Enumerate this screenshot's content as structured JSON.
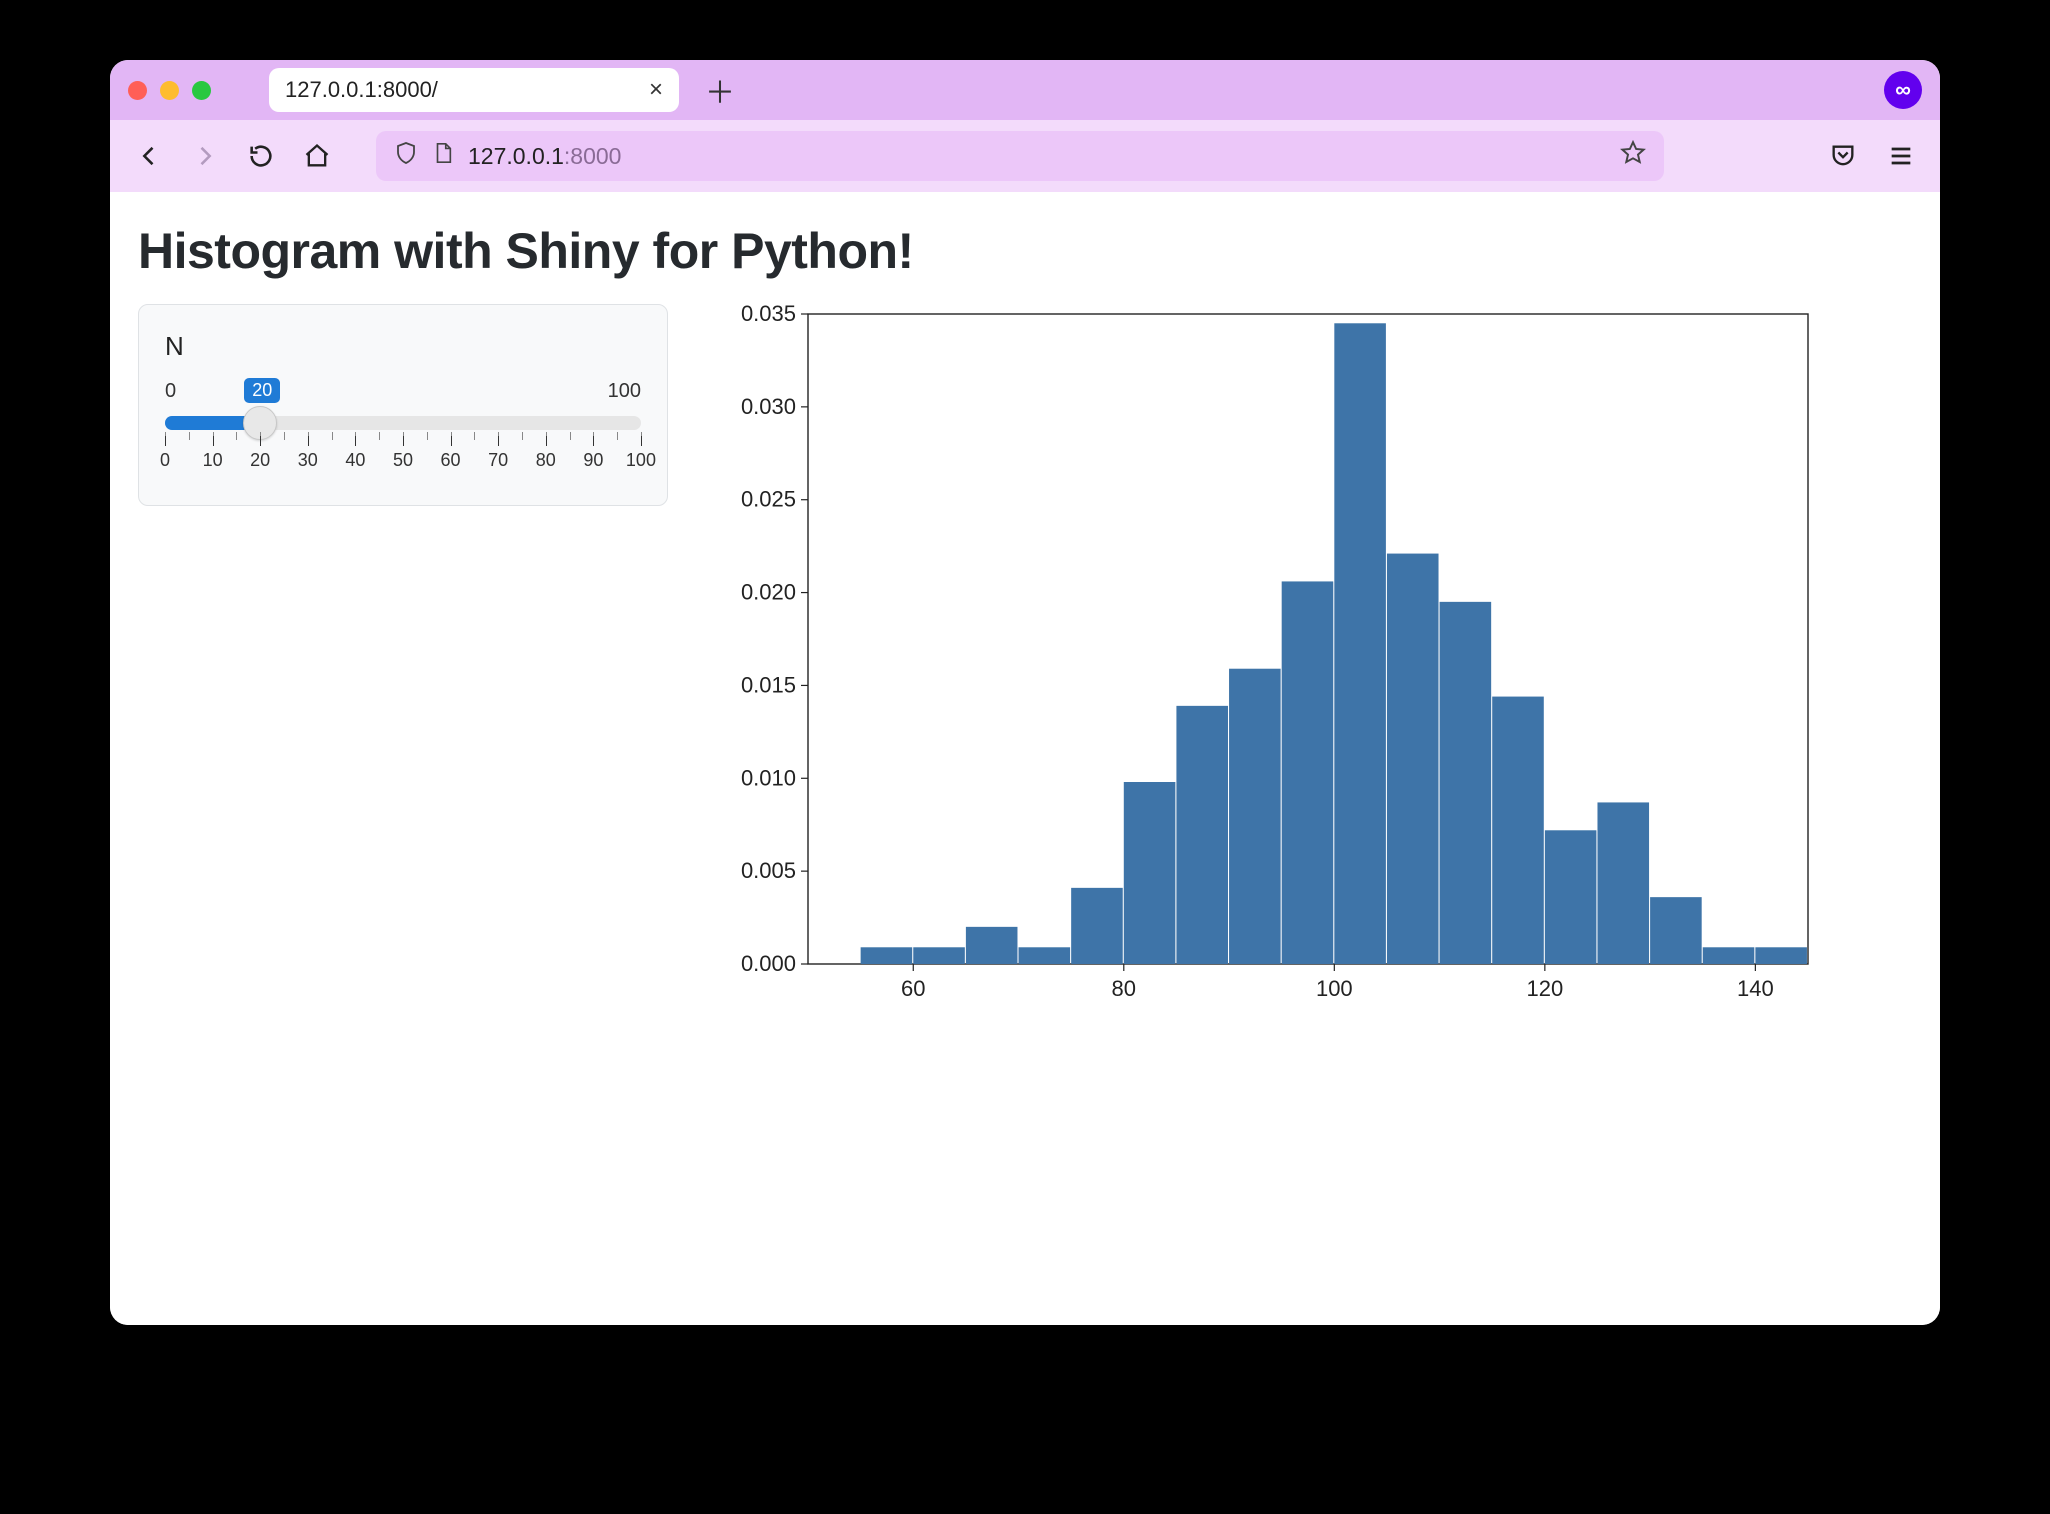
{
  "browser": {
    "tab_title": "127.0.0.1:8000/",
    "url_host": "127.0.0.1",
    "url_port": ":8000"
  },
  "page": {
    "title": "Histogram with Shiny for Python!"
  },
  "slider": {
    "label": "N",
    "min": 0,
    "max": 100,
    "value": 20,
    "ticks": [
      0,
      10,
      20,
      30,
      40,
      50,
      60,
      70,
      80,
      90,
      100
    ]
  },
  "chart_data": {
    "type": "bar",
    "title": "",
    "xlabel": "",
    "ylabel": "",
    "xlim": [
      50,
      145
    ],
    "ylim": [
      0,
      0.035
    ],
    "xticks": [
      60,
      80,
      100,
      120,
      140
    ],
    "yticks": [
      0.0,
      0.005,
      0.01,
      0.015,
      0.02,
      0.025,
      0.03,
      0.035
    ],
    "bin_width": 5,
    "bins": [
      {
        "x": 55,
        "y": 0.0009
      },
      {
        "x": 60,
        "y": 0.0009
      },
      {
        "x": 65,
        "y": 0.002
      },
      {
        "x": 70,
        "y": 0.0009
      },
      {
        "x": 75,
        "y": 0.0041
      },
      {
        "x": 80,
        "y": 0.0098
      },
      {
        "x": 85,
        "y": 0.0139
      },
      {
        "x": 90,
        "y": 0.0159
      },
      {
        "x": 95,
        "y": 0.0206
      },
      {
        "x": 100,
        "y": 0.0345
      },
      {
        "x": 105,
        "y": 0.0221
      },
      {
        "x": 110,
        "y": 0.0195
      },
      {
        "x": 115,
        "y": 0.0144
      },
      {
        "x": 120,
        "y": 0.0072
      },
      {
        "x": 125,
        "y": 0.0087
      },
      {
        "x": 130,
        "y": 0.0036
      },
      {
        "x": 135,
        "y": 0.0009
      },
      {
        "x": 140,
        "y": 0.0009
      }
    ]
  }
}
